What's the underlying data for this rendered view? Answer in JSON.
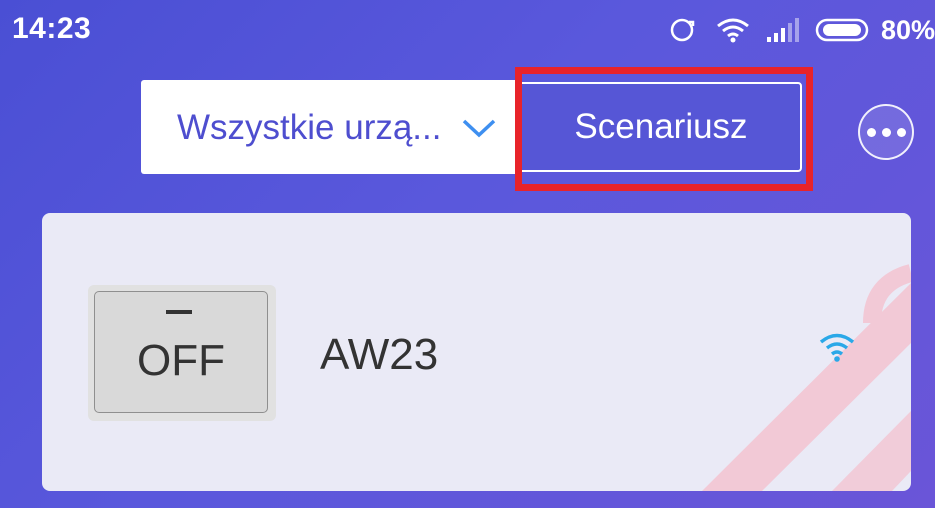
{
  "status_bar": {
    "time": "14:23",
    "battery_percent": "80%",
    "icons": [
      "sync-icon",
      "wifi-icon",
      "cellular-signal-icon",
      "battery-icon"
    ]
  },
  "toolbar": {
    "device_filter": {
      "selected": "Wszystkie urzą..."
    },
    "scenario_label": "Scenariusz",
    "more_icon": "more-options-icon"
  },
  "device": {
    "name": "AW23",
    "switch_label": "OFF",
    "connection_icon": "wifi-signal-icon"
  },
  "colors": {
    "accent": "#5656d6",
    "highlight": "#e8232a",
    "wifi": "#2aa8e8"
  }
}
